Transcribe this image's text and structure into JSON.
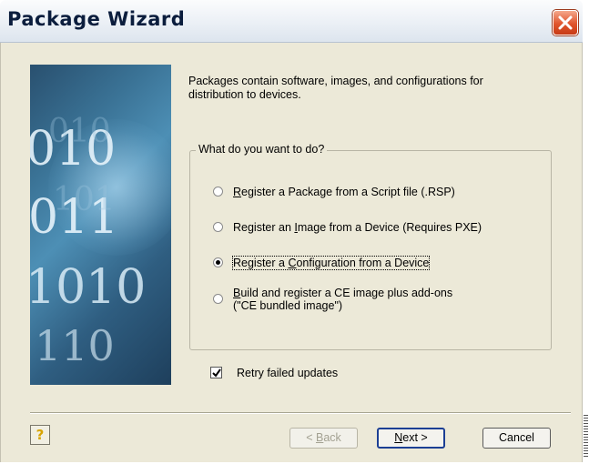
{
  "window": {
    "title": "Package Wizard"
  },
  "intro_text": "Packages contain software, images, and configurations for distribution to devices.",
  "group": {
    "legend": "What do you want to do?",
    "options": [
      {
        "pre": "",
        "key": "R",
        "post": "egister a Package from a Script file (.RSP)",
        "checked": false
      },
      {
        "pre": "Register an ",
        "key": "I",
        "post": "mage from a Device (Requires PXE)",
        "checked": false
      },
      {
        "pre": "Register a ",
        "key": "C",
        "post": "onfiguration from a Device",
        "checked": true
      },
      {
        "pre": "",
        "key": "B",
        "post": "uild and register a CE image plus add-ons",
        "line2": "(\"CE bundled image\")",
        "checked": false
      }
    ]
  },
  "retry": {
    "label": "Retry failed updates",
    "checked": true
  },
  "buttons": {
    "help": "?",
    "back_pre": "< ",
    "back_key": "B",
    "back_post": "ack",
    "next_key": "N",
    "next_post": "ext >",
    "cancel": "Cancel"
  },
  "side_image_text": [
    "010",
    "011",
    "1010",
    "110"
  ],
  "colors": {
    "dialog_bg": "#ece9d8",
    "close_button": "#e0542c",
    "default_button_border": "#1c3f94"
  },
  "icons": {
    "close": "close-x-icon",
    "help": "help-question-icon",
    "checkbox": "checkmark-icon"
  }
}
